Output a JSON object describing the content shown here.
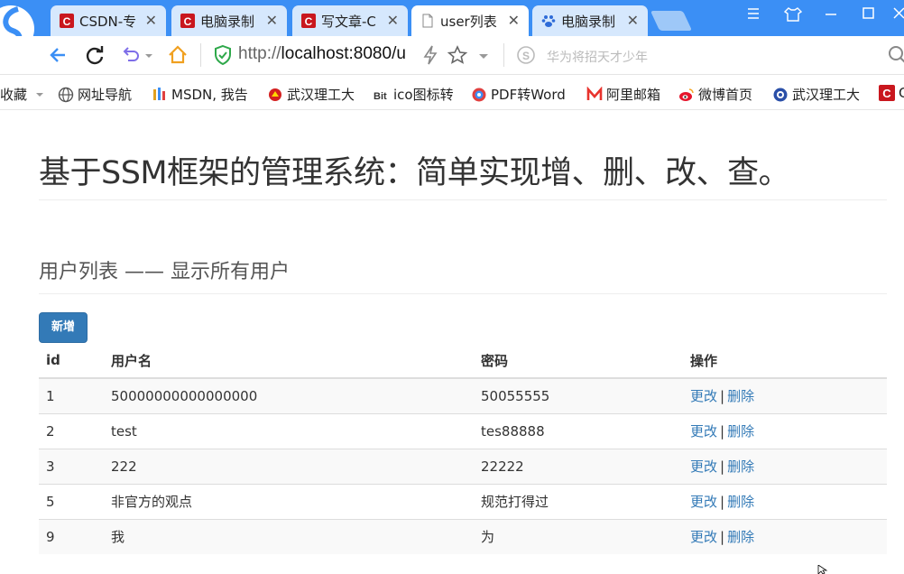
{
  "browser": {
    "tabs": [
      {
        "title": "CSDN-专",
        "icon": "csdn-icon",
        "active": false
      },
      {
        "title": "电脑录制",
        "icon": "csdn-icon",
        "active": false
      },
      {
        "title": "写文章-C",
        "icon": "csdn-icon",
        "active": false
      },
      {
        "title": "user列表",
        "icon": "page-icon",
        "active": true
      },
      {
        "title": "电脑录制",
        "icon": "baidu-icon",
        "active": false
      }
    ],
    "tab_close": "✕",
    "url_prefix": "http://",
    "url_host": "localhost:8080/u",
    "search_placeholder": "华为将招天才少年",
    "bookmarks": [
      {
        "label": "收藏",
        "icon": ""
      },
      {
        "label": "网址导航",
        "icon": "globe-icon"
      },
      {
        "label": "MSDN, 我告",
        "icon": "msdn-icon"
      },
      {
        "label": "武汉理工大",
        "icon": "whut-icon"
      },
      {
        "label": "ico图标转",
        "icon": "bit-icon"
      },
      {
        "label": "PDF转Word",
        "icon": "pdf-icon"
      },
      {
        "label": "阿里邮箱",
        "icon": "mail-icon"
      },
      {
        "label": "微博首页",
        "icon": "weibo-icon"
      },
      {
        "label": "武汉理工大",
        "icon": "whut2-icon"
      },
      {
        "label": "C",
        "icon": "csdn-icon"
      }
    ]
  },
  "page": {
    "title": "基于SSM框架的管理系统：简单实现增、删、改、查。",
    "subtitle": "用户列表 —— 显示所有用户",
    "add_button": "新增",
    "table": {
      "headers": [
        "id",
        "用户名",
        "密码",
        "操作"
      ],
      "rows": [
        {
          "id": "1",
          "name": "50000000000000000",
          "password": "50055555"
        },
        {
          "id": "2",
          "name": "test",
          "password": "tes88888"
        },
        {
          "id": "3",
          "name": "222",
          "password": "22222"
        },
        {
          "id": "5",
          "name": "非官方的观点",
          "password": "规范打得过"
        },
        {
          "id": "9",
          "name": "我",
          "password": "为"
        }
      ],
      "edit_label": "更改",
      "delete_label": "删除",
      "separator": "|"
    }
  },
  "colors": {
    "titlebar": "#3b8ff5",
    "primary": "#337ab7",
    "link": "#337ab7"
  }
}
